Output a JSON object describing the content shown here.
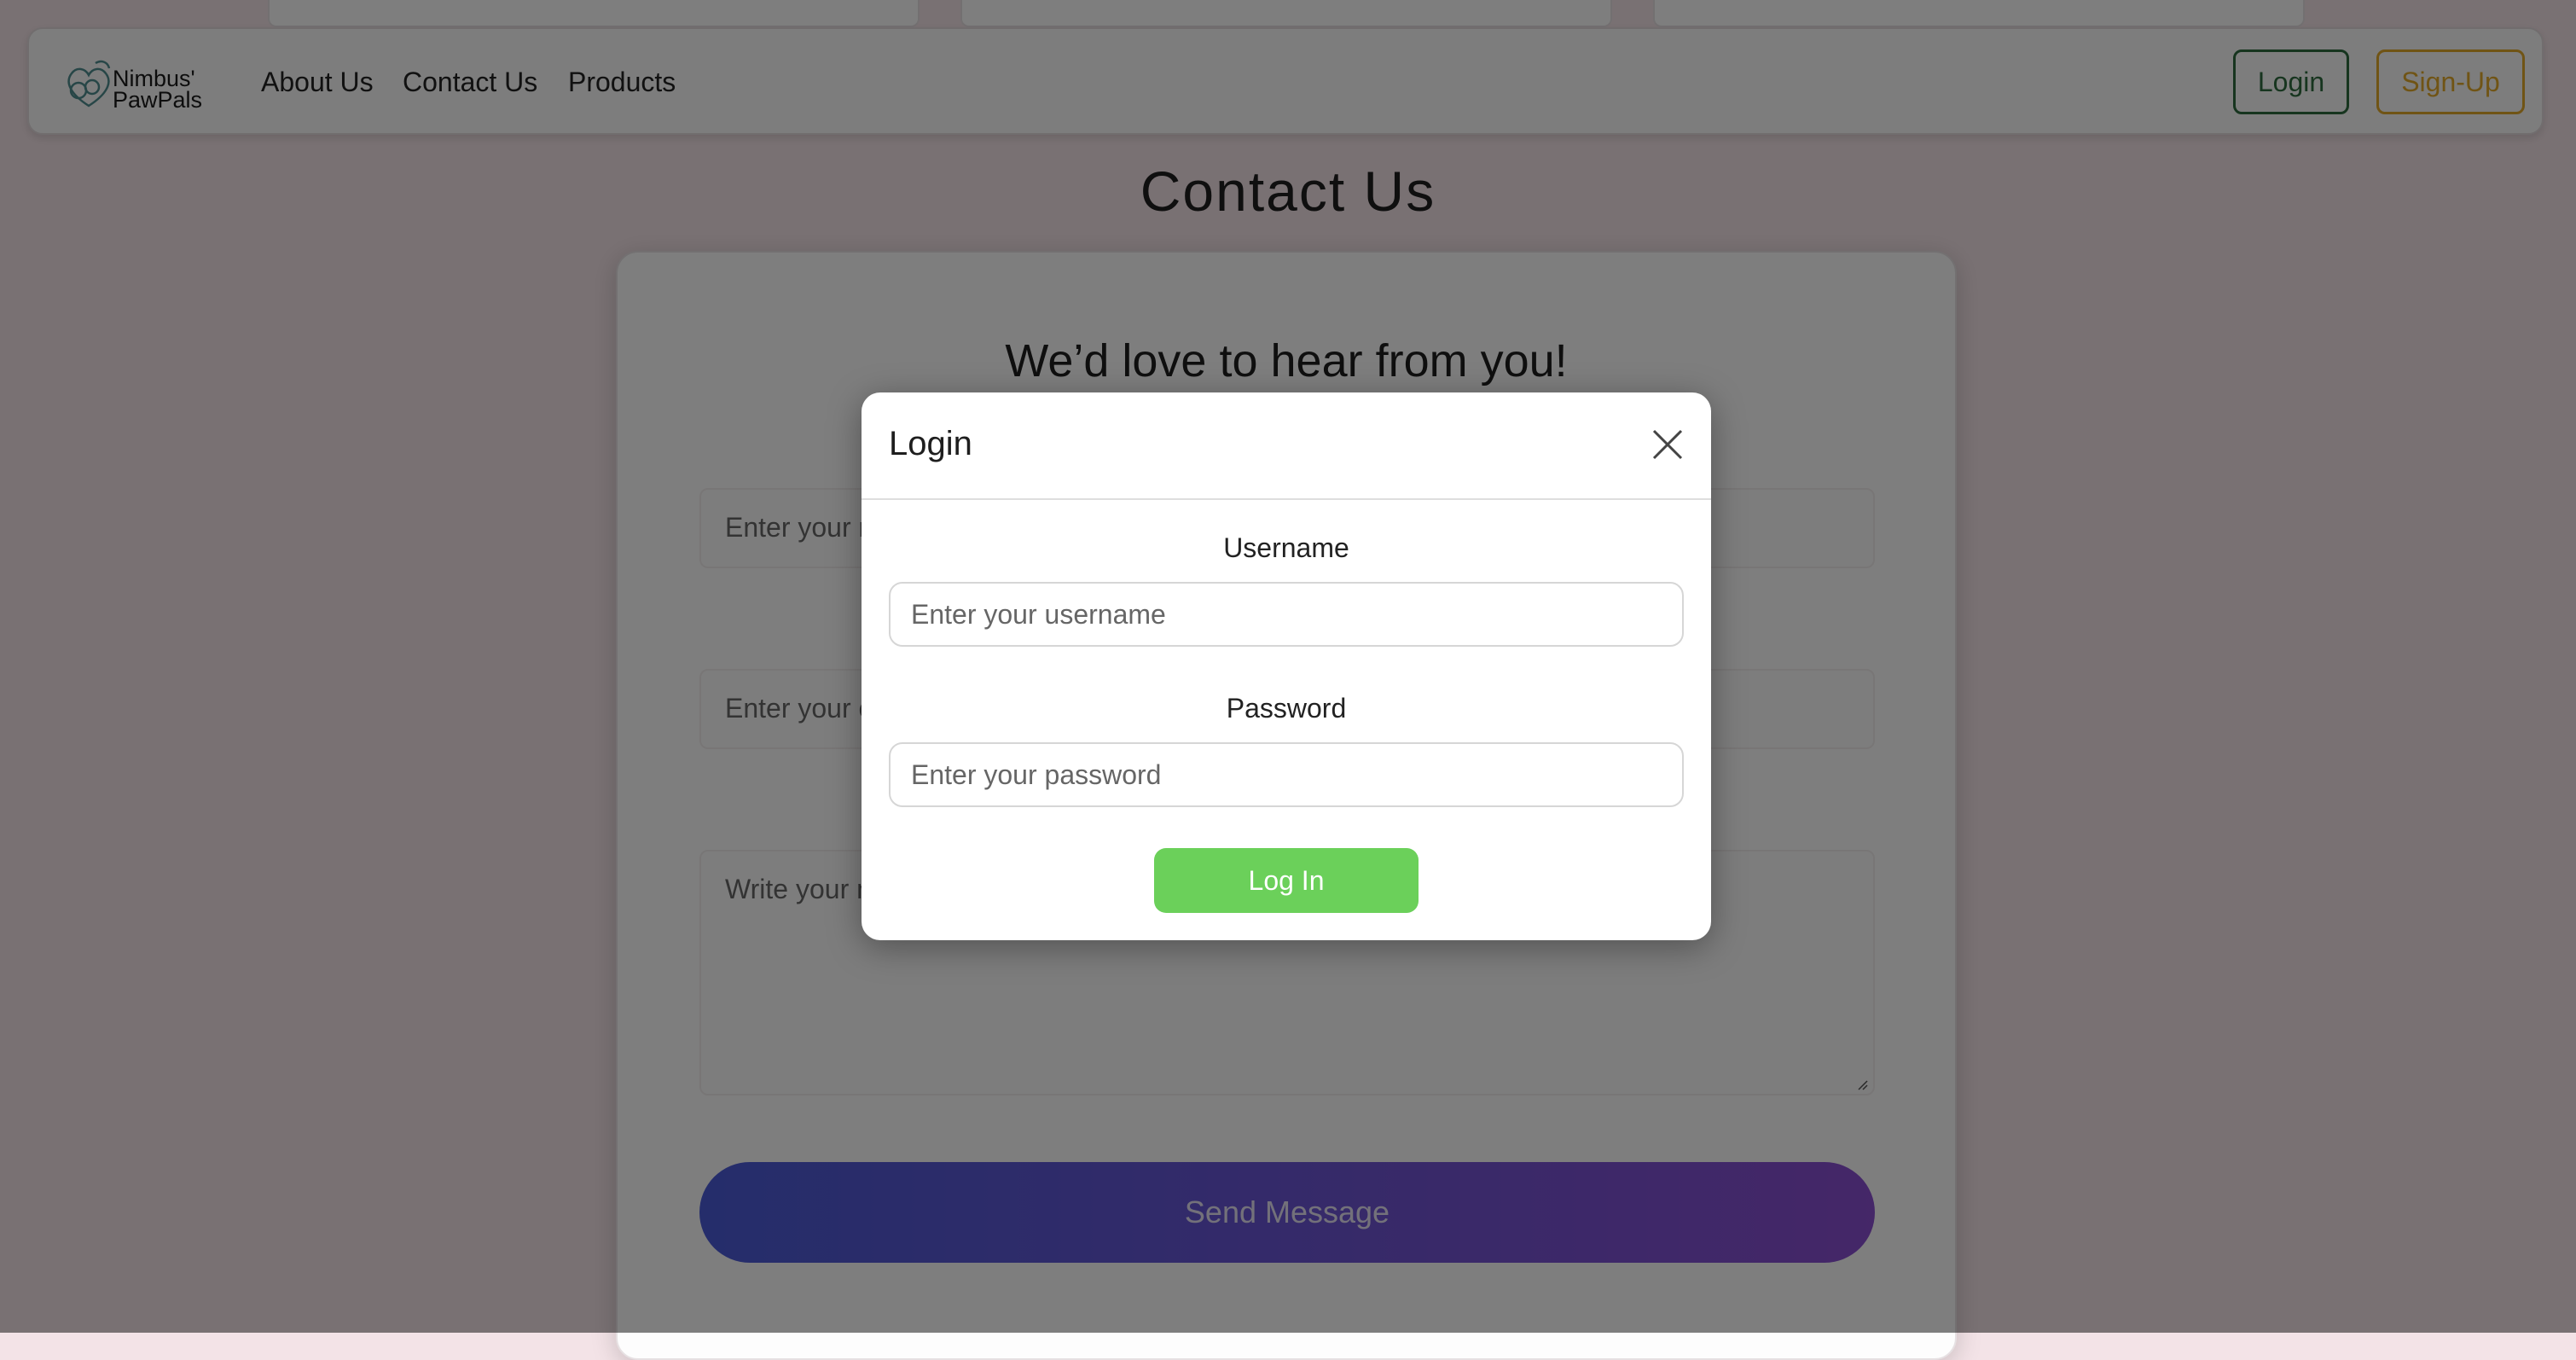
{
  "navbar": {
    "brand_line1": "Nimbus'",
    "brand_line2": "PawPals",
    "links": [
      "About Us",
      "Contact Us",
      "Products"
    ],
    "login_label": "Login",
    "signup_label": "Sign-Up",
    "login_color": "#2e6b3e",
    "signup_color": "#e1a92b"
  },
  "page": {
    "title": "Contact Us",
    "heading": "We’d love to hear from you!",
    "name_placeholder": "Enter your name",
    "email_placeholder": "Enter your email",
    "message_placeholder": "Write your message",
    "send_label": "Send Message"
  },
  "modal": {
    "title": "Login",
    "username_label": "Username",
    "username_placeholder": "Enter your username",
    "password_label": "Password",
    "password_placeholder": "Enter your password",
    "submit_label": "Log In",
    "submit_color": "#6bd05a"
  }
}
